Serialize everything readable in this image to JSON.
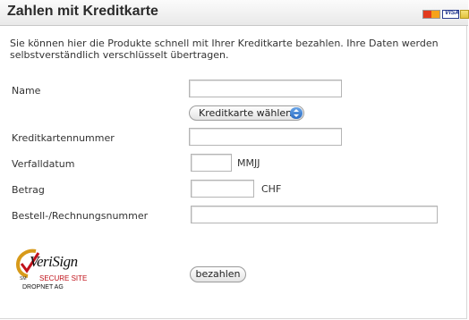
{
  "header": {
    "title": "Zahlen mit Kreditkarte",
    "card_logos": [
      "mastercard-icon",
      "visa-icon",
      "card-icon"
    ],
    "visa_text": "VISA"
  },
  "intro": {
    "text": "Sie können hier die Produkte schnell mit Ihrer Kreditkarte bezahlen. Ihre Daten werden selbstverständlich verschlüsselt übertragen."
  },
  "form": {
    "name": {
      "label": "Name",
      "value": ""
    },
    "card_type": {
      "selected": "Kreditkarte wählen"
    },
    "card_number": {
      "label": "Kreditkartennummer",
      "value": ""
    },
    "expiry": {
      "label": "Verfalldatum",
      "value": "",
      "hint": "MMJJ"
    },
    "amount": {
      "label": "Betrag",
      "value": "",
      "currency": "CHF"
    },
    "order_number": {
      "label": "Bestell-/Rechnungsnummer",
      "value": ""
    },
    "submit_label": "bezahlen"
  },
  "seal": {
    "brand": "VeriSign",
    "secure_text": "SECURE SITE",
    "sm": "SM",
    "company": "DROPNET AG"
  },
  "colors": {
    "secure_red": "#c0121a",
    "stepper_blue": "#2b6cc4"
  }
}
